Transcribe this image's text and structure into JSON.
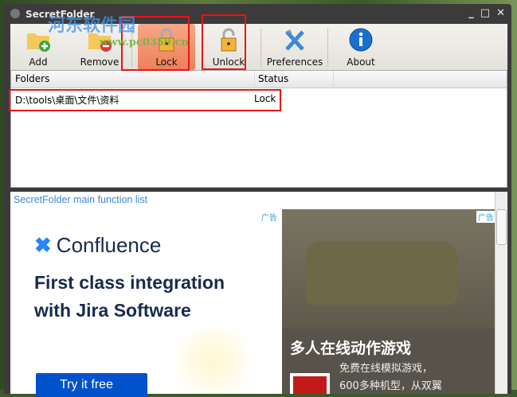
{
  "window": {
    "title": "SecretFolder",
    "minimize": "_",
    "maximize": "□",
    "close": "✕"
  },
  "toolbar": {
    "add": "Add",
    "remove": "Remove",
    "lock": "Lock",
    "unlock": "Unlock",
    "preferences": "Preferences",
    "about": "About"
  },
  "list": {
    "columns": [
      "Folders",
      "Status"
    ],
    "rows": [
      {
        "folder": "D:\\tools\\桌面\\文件\\资料",
        "status": "Lock"
      }
    ]
  },
  "web": {
    "link": "SecretFolder main function list",
    "ad_left": {
      "tag": "广告",
      "brand": "Confluence",
      "headline1": "First class integration",
      "headline2": "with Jira Software",
      "cta": "Try it free"
    },
    "ad_right": {
      "tag": "广告",
      "title": "多人在线动作游戏",
      "desc1": "免费在线模拟游戏，",
      "desc2": "600多种机型，从双翼"
    }
  },
  "watermark": {
    "name": "河东软件园",
    "url": "www.pc0359.cn"
  },
  "colors": {
    "accent": "#ee7f58",
    "highlight": "#e8141a",
    "link": "#3a8ad8"
  }
}
